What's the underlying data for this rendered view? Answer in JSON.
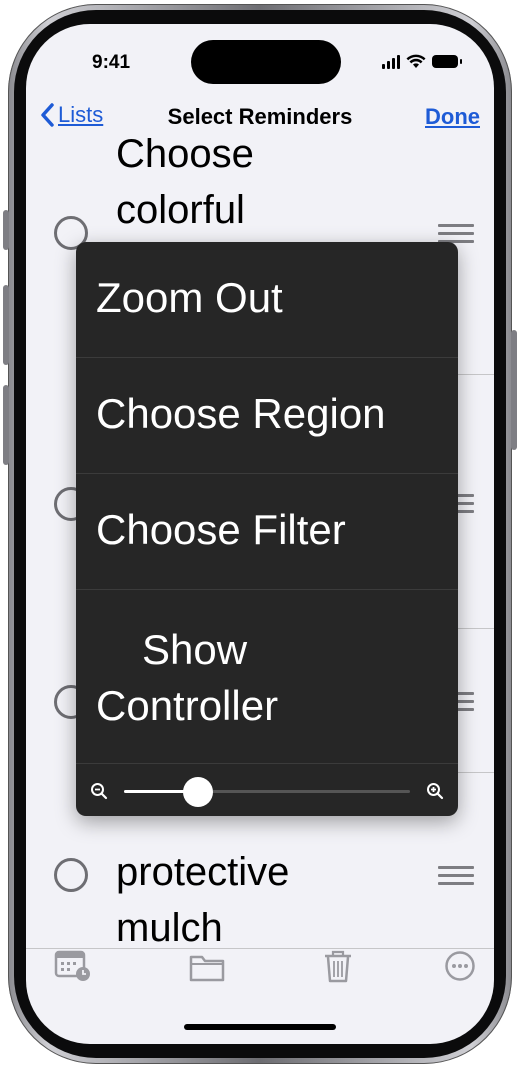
{
  "status_bar": {
    "time": "9:41"
  },
  "nav": {
    "back_label": "Lists",
    "title": "Select Reminders",
    "done_label": "Done"
  },
  "reminders": [
    {
      "line1": "Choose",
      "line2": "colorful"
    },
    {
      "line1": "",
      "line2": ""
    },
    {
      "line1": "",
      "line2": ""
    },
    {
      "line1": "protective",
      "line2": "mulch"
    }
  ],
  "zoom_menu": {
    "items": [
      "Zoom Out",
      "Choose Region",
      "Choose Filter",
      "Show",
      "Controller"
    ],
    "zoom_slider": {
      "level": 0.26
    },
    "icons": {
      "min": "zoom-out-icon",
      "max": "zoom-in-icon"
    }
  },
  "toolbar": {
    "icons": [
      "calendar-clock-icon",
      "folder-icon",
      "trash-icon",
      "more-icon"
    ]
  },
  "colors": {
    "accent": "#1e5bd6",
    "menu_bg": "#262626",
    "screen_bg": "#f2f2f7"
  }
}
